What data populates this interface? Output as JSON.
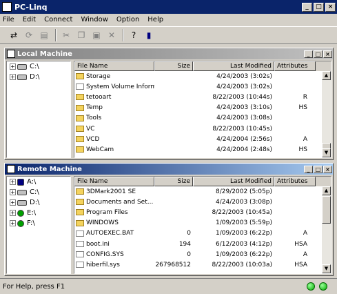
{
  "app": {
    "title": "PC-Linq"
  },
  "menu": [
    "File",
    "Edit",
    "Connect",
    "Window",
    "Option",
    "Help"
  ],
  "toolbar": [
    {
      "icon": "connect-icon",
      "enabled": true
    },
    {
      "icon": "refresh-icon",
      "enabled": false
    },
    {
      "icon": "print-icon",
      "enabled": false
    },
    {
      "icon": "cut-icon",
      "enabled": false
    },
    {
      "icon": "copy-icon",
      "enabled": false
    },
    {
      "icon": "paste-icon",
      "enabled": false
    },
    {
      "icon": "delete-icon",
      "enabled": false
    },
    {
      "icon": "help-icon",
      "enabled": true
    },
    {
      "icon": "book-icon",
      "enabled": true
    }
  ],
  "columns": {
    "name": "File Name",
    "size": "Size",
    "modified": "Last Modified",
    "attributes": "Attributes"
  },
  "local": {
    "title": "Local Machine",
    "drives": [
      "C:\\",
      "D:\\"
    ],
    "files": [
      {
        "name": "Storage",
        "size": "",
        "modified": "4/24/2003 (3:02s)",
        "attr": "",
        "type": "folder"
      },
      {
        "name": "System Volume Information",
        "size": "",
        "modified": "4/24/2003 (3:02s)",
        "attr": "",
        "type": "file"
      },
      {
        "name": "tetooart",
        "size": "",
        "modified": "8/22/2003 (10:44s)",
        "attr": "R",
        "type": "folder"
      },
      {
        "name": "Temp",
        "size": "",
        "modified": "4/24/2003 (3:10s)",
        "attr": "HS",
        "type": "folder"
      },
      {
        "name": "Tools",
        "size": "",
        "modified": "4/24/2003 (3:08s)",
        "attr": "",
        "type": "folder"
      },
      {
        "name": "VC",
        "size": "",
        "modified": "8/22/2003 (10:45s)",
        "attr": "",
        "type": "folder"
      },
      {
        "name": "VCD",
        "size": "",
        "modified": "4/24/2004 (2:56s)",
        "attr": "A",
        "type": "folder"
      },
      {
        "name": "WebCam",
        "size": "",
        "modified": "4/24/2004 (2:48s)",
        "attr": "HS",
        "type": "folder"
      }
    ]
  },
  "remote": {
    "title": "Remote Machine",
    "drives": [
      "A:\\",
      "C:\\",
      "D:\\",
      "E:\\",
      "F:\\"
    ],
    "files": [
      {
        "name": "3DMark2001 SE",
        "size": "",
        "modified": "8/29/2002 (5:05p)",
        "attr": "",
        "type": "folder"
      },
      {
        "name": "Documents and Set...",
        "size": "",
        "modified": "4/24/2003 (3:08p)",
        "attr": "",
        "type": "folder"
      },
      {
        "name": "Program Files",
        "size": "",
        "modified": "8/22/2003 (10:45a)",
        "attr": "",
        "type": "folder"
      },
      {
        "name": "WINDOWS",
        "size": "",
        "modified": "1/09/2003 (5:59p)",
        "attr": "",
        "type": "folder"
      },
      {
        "name": "AUTOEXEC.BAT",
        "size": "0",
        "modified": "1/09/2003 (6:22p)",
        "attr": "A",
        "type": "file"
      },
      {
        "name": "boot.ini",
        "size": "194",
        "modified": "6/12/2003 (4:12p)",
        "attr": "HSA",
        "type": "file"
      },
      {
        "name": "CONFIG.SYS",
        "size": "0",
        "modified": "1/09/2003 (6:22p)",
        "attr": "A",
        "type": "file"
      },
      {
        "name": "hiberfil.sys",
        "size": "267968512",
        "modified": "8/22/2003 (10:03a)",
        "attr": "HSA",
        "type": "file"
      }
    ]
  },
  "status": {
    "text": "For Help, press F1"
  }
}
